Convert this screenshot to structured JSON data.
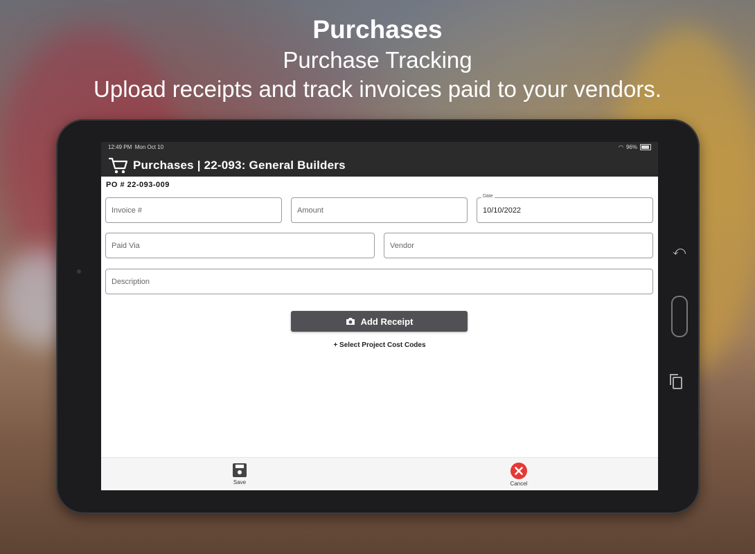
{
  "hero": {
    "title": "Purchases",
    "subtitle": "Purchase Tracking",
    "description": "Upload receipts and track invoices paid to your vendors."
  },
  "status_bar": {
    "time": "12:49 PM",
    "date": "Mon Oct 10",
    "battery": "96%",
    "wifi_icon": "wifi-icon"
  },
  "app_bar": {
    "icon": "cart-icon",
    "title": "Purchases | 22-093: General Builders"
  },
  "form": {
    "po_number": "PO # 22-093-009",
    "invoice": {
      "placeholder": "Invoice #",
      "value": ""
    },
    "amount": {
      "placeholder": "Amount",
      "value": ""
    },
    "date": {
      "label": "Date",
      "value": "10/10/2022"
    },
    "paid_via": {
      "placeholder": "Paid Via",
      "value": ""
    },
    "vendor": {
      "placeholder": "Vendor",
      "value": ""
    },
    "description": {
      "placeholder": "Description",
      "value": ""
    },
    "add_receipt_label": "Add Receipt",
    "cost_codes_label": "+ Select Project Cost Codes"
  },
  "bottom_bar": {
    "save_label": "Save",
    "cancel_label": "Cancel"
  },
  "colors": {
    "appbar": "#2b2b2b",
    "button": "#515155",
    "cancel": "#e53935"
  }
}
